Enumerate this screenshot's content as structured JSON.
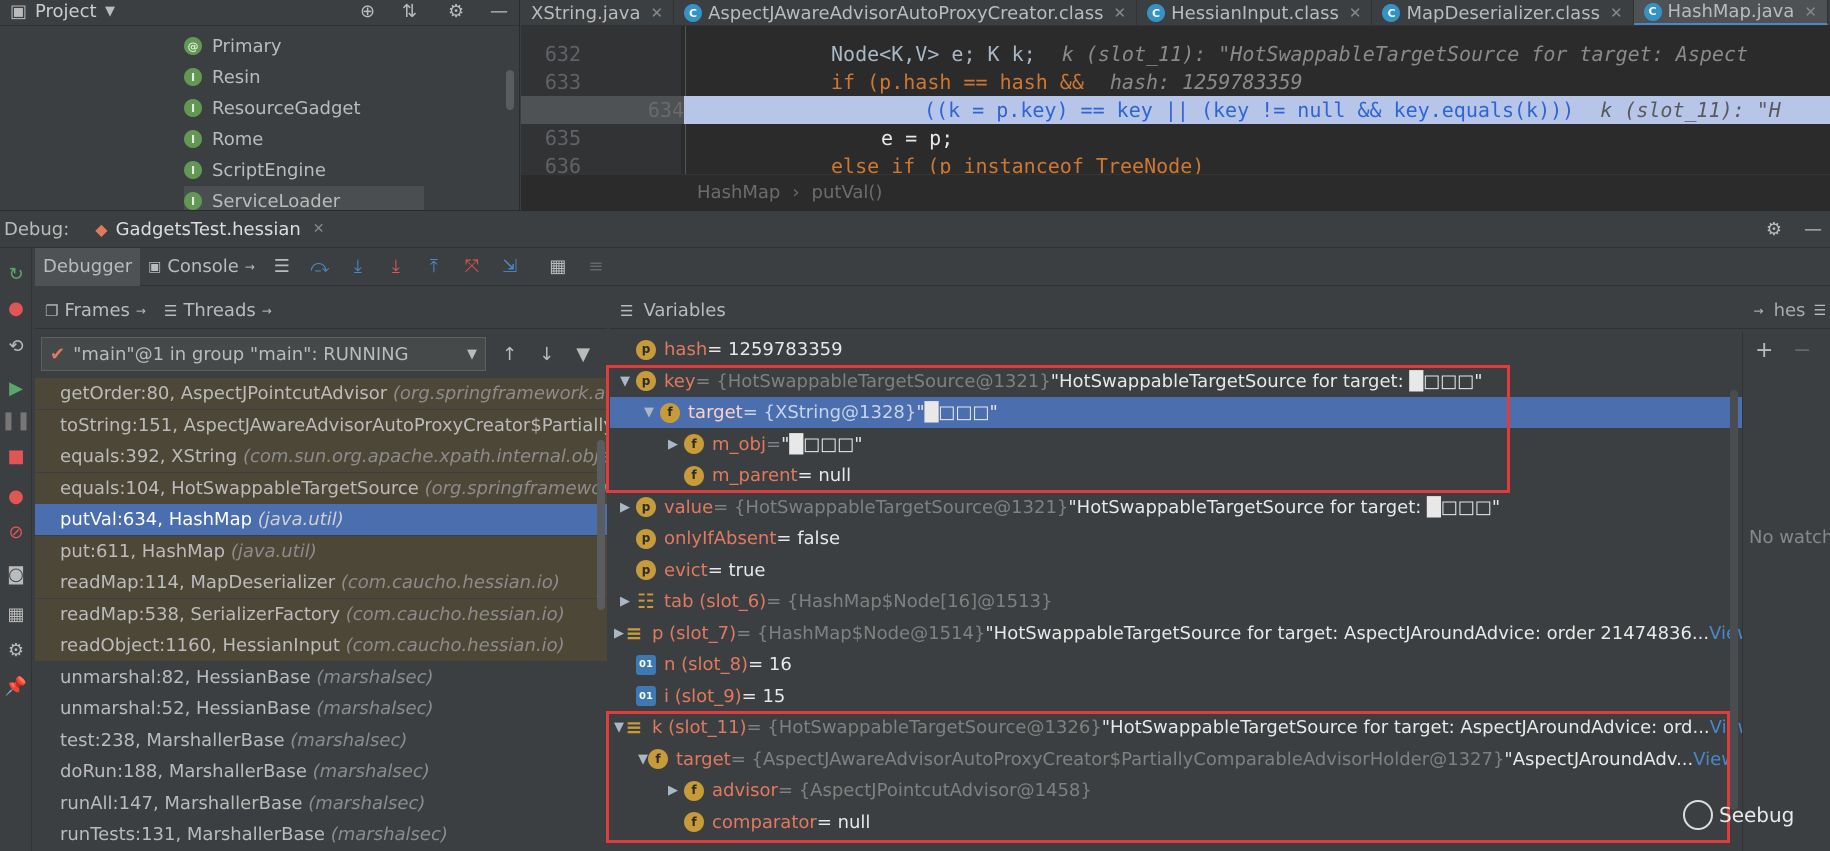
{
  "project": {
    "title": "Project",
    "items": [
      "Primary",
      "Resin",
      "ResourceGadget",
      "Rome",
      "ScriptEngine",
      "ServiceLoader"
    ]
  },
  "tabs": [
    {
      "label": "XString.java"
    },
    {
      "label": "AspectJAwareAdvisorAutoProxyCreator.class"
    },
    {
      "label": "HessianInput.class"
    },
    {
      "label": "MapDeserializer.class"
    },
    {
      "label": "HashMap.java"
    }
  ],
  "code": {
    "l632_num": "632",
    "l633_num": "633",
    "l634_num": "634",
    "l635_num": "635",
    "l636_num": "636",
    "l632_a": "Node<K,V> e; K k;",
    "l632_hint": "k (slot_11): \"HotSwappableTargetSource for target: Aspect",
    "l633_a": "if (p.hash == hash &&",
    "l633_hint": "hash: 1259783359",
    "l634_a": "((k = p.key) == key || (key != null && key.equals(k)))",
    "l634_hint": "k (slot_11): \"H",
    "l635_a": "e = p;",
    "l636_a": "else if (p instanceof TreeNode)"
  },
  "breadcrumb": {
    "class": "HashMap",
    "method": "putVal()"
  },
  "debug": {
    "label": "Debug:",
    "session": "GadgetsTest.hessian",
    "debugger_tab": "Debugger",
    "console_tab": "Console"
  },
  "frames_tab": "Frames",
  "threads_tab": "Threads",
  "variables_tab": "Variables",
  "watch_tab": "hes",
  "thread_select": "\"main\"@1 in group \"main\": RUNNING",
  "frames": [
    {
      "m": "getOrder:80, AspectJPointcutAdvisor",
      "p": "(org.springframework.aop"
    },
    {
      "m": "toString:151, AspectJAwareAdvisorAutoProxyCreator$PartiallyC",
      "p": ""
    },
    {
      "m": "equals:392, XString",
      "p": "(com.sun.org.apache.xpath.internal.objects)"
    },
    {
      "m": "equals:104, HotSwappableTargetSource",
      "p": "(org.springframework.a"
    },
    {
      "m": "putVal:634, HashMap",
      "p": "(java.util)"
    },
    {
      "m": "put:611, HashMap",
      "p": "(java.util)"
    },
    {
      "m": "readMap:114, MapDeserializer",
      "p": "(com.caucho.hessian.io)"
    },
    {
      "m": "readMap:538, SerializerFactory",
      "p": "(com.caucho.hessian.io)"
    },
    {
      "m": "readObject:1160, HessianInput",
      "p": "(com.caucho.hessian.io)"
    },
    {
      "m": "unmarshal:82, HessianBase",
      "p": "(marshalsec)"
    },
    {
      "m": "unmarshal:52, HessianBase",
      "p": "(marshalsec)"
    },
    {
      "m": "test:238, MarshallerBase",
      "p": "(marshalsec)"
    },
    {
      "m": "doRun:188, MarshallerBase",
      "p": "(marshalsec)"
    },
    {
      "m": "runAll:147, MarshallerBase",
      "p": "(marshalsec)"
    },
    {
      "m": "runTests:131, MarshallerBase",
      "p": "(marshalsec)"
    }
  ],
  "vars": [
    {
      "n": "hash",
      "t": "",
      "v": "= 1259783359",
      "b": "p"
    },
    {
      "n": "key",
      "t": "= {HotSwappableTargetSource@1321}",
      "v": "\"HotSwappableTargetSource for target: █□□□\"",
      "b": "p"
    },
    {
      "n": "target",
      "t": "= {XString@1328}",
      "v": "\"█□□□\"",
      "b": "f"
    },
    {
      "n": "m_obj",
      "t": "=",
      "v": "\"█□□□\"",
      "b": "f"
    },
    {
      "n": "m_parent",
      "t": "",
      "v": "= null",
      "b": "f"
    },
    {
      "n": "value",
      "t": "= {HotSwappableTargetSource@1321}",
      "v": "\"HotSwappableTargetSource for target: █□□□\"",
      "b": "p"
    },
    {
      "n": "onlyIfAbsent",
      "t": "",
      "v": "= false",
      "b": "p"
    },
    {
      "n": "evict",
      "t": "",
      "v": "= true",
      "b": "p"
    },
    {
      "n": "tab (slot_6)",
      "t": "= {HashMap$Node[16]@1513}",
      "v": "",
      "b": "arr"
    },
    {
      "n": "p (slot_7)",
      "t": "= {HashMap$Node@1514}",
      "v": "\"HotSwappableTargetSource for target: AspectJAroundAdvice: order 21474836...",
      "view": "View",
      "b": "obj"
    },
    {
      "n": "n (slot_8)",
      "t": "",
      "v": "= 16",
      "b": "o1"
    },
    {
      "n": "i (slot_9)",
      "t": "",
      "v": "= 15",
      "b": "o1"
    },
    {
      "n": "k (slot_11)",
      "t": "= {HotSwappableTargetSource@1326}",
      "v": "\"HotSwappableTargetSource for target: AspectJAroundAdvice: ord...",
      "view": "View",
      "b": "obj"
    },
    {
      "n": "target",
      "t": "= {AspectJAwareAdvisorAutoProxyCreator$PartiallyComparableAdvisorHolder@1327}",
      "v": "\"AspectJAroundAdv...",
      "view": "View",
      "b": "f"
    },
    {
      "n": "advisor",
      "t": "= {AspectJPointcutAdvisor@1458}",
      "v": "",
      "b": "f"
    },
    {
      "n": "comparator",
      "t": "",
      "v": "= null",
      "b": "f"
    }
  ],
  "watch": {
    "empty": "No watch"
  },
  "watermark": "Seebug"
}
